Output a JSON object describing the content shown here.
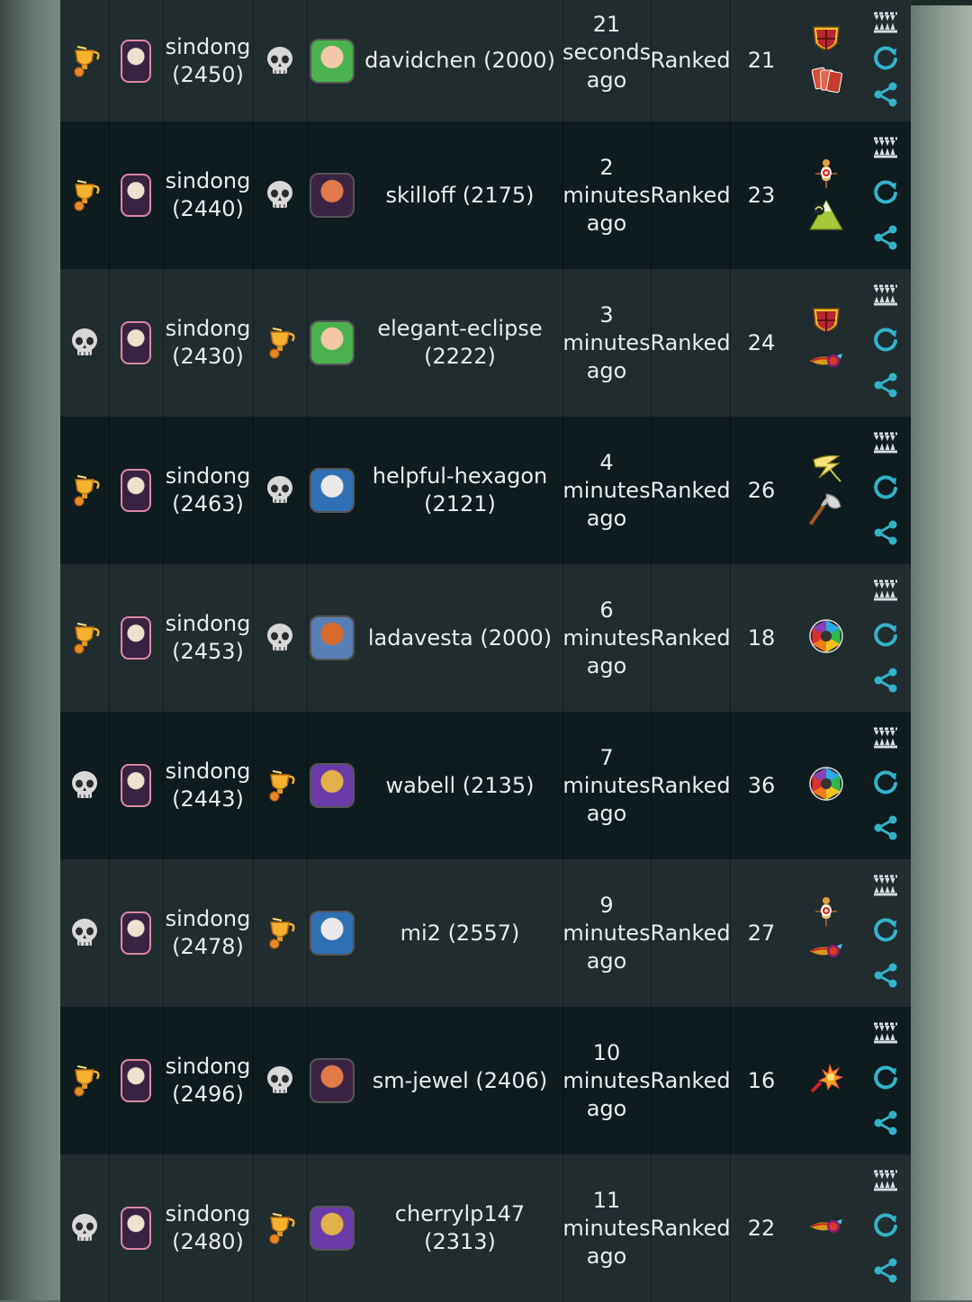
{
  "rows": [
    {
      "r1": "trophy",
      "p1": "sindong (2450)",
      "r2": "skull",
      "av2": "green-hair",
      "p2": "davidchen (2000)",
      "time": "21 seconds ago",
      "mode": "Ranked",
      "turns": "21",
      "icons": [
        "shield",
        "cards"
      ],
      "dark": false
    },
    {
      "r1": "trophy",
      "p1": "sindong (2440)",
      "r2": "skull",
      "av2": "dark-warlord",
      "p2": "skilloff (2175)",
      "time": "2 minutes ago",
      "mode": "Ranked",
      "turns": "23",
      "icons": [
        "target",
        "mountain"
      ],
      "dark": true
    },
    {
      "r1": "skull",
      "p1": "sindong (2430)",
      "r2": "trophy",
      "av2": "green-hair",
      "p2": "elegant-eclipse (2222)",
      "time": "3 minutes ago",
      "mode": "Ranked",
      "turns": "24",
      "icons": [
        "shield",
        "comet"
      ],
      "dark": false
    },
    {
      "r1": "trophy",
      "p1": "sindong (2463)",
      "r2": "skull",
      "av2": "wizard",
      "p2": "helpful-hexagon (2121)",
      "time": "4 minutes ago",
      "mode": "Ranked",
      "turns": "26",
      "icons": [
        "lightning",
        "axe"
      ],
      "dark": true
    },
    {
      "r1": "trophy",
      "p1": "sindong (2453)",
      "r2": "skull",
      "av2": "red-hair",
      "p2": "ladavesta (2000)",
      "time": "6 minutes ago",
      "mode": "Ranked",
      "turns": "18",
      "icons": [
        "rainbow-wheel"
      ],
      "dark": false
    },
    {
      "r1": "skull",
      "p1": "sindong (2443)",
      "r2": "trophy",
      "av2": "armored-knight",
      "p2": "wabell (2135)",
      "time": "7 minutes ago",
      "mode": "Ranked",
      "turns": "36",
      "icons": [
        "rainbow-wheel"
      ],
      "dark": true
    },
    {
      "r1": "skull",
      "p1": "sindong (2478)",
      "r2": "trophy",
      "av2": "wizard",
      "p2": "mi2 (2557)",
      "time": "9 minutes ago",
      "mode": "Ranked",
      "turns": "27",
      "icons": [
        "target",
        "comet"
      ],
      "dark": false
    },
    {
      "r1": "trophy",
      "p1": "sindong (2496)",
      "r2": "skull",
      "av2": "dark-warlord",
      "p2": "sm-jewel (2406)",
      "time": "10 minutes ago",
      "mode": "Ranked",
      "turns": "16",
      "icons": [
        "explosion"
      ],
      "dark": true
    },
    {
      "r1": "skull",
      "p1": "sindong (2480)",
      "r2": "trophy",
      "av2": "armored-knight",
      "p2": "cherrylp147 (2313)",
      "time": "11 minutes ago",
      "mode": "Ranked",
      "turns": "22",
      "icons": [
        "comet"
      ],
      "dark": false
    }
  ]
}
